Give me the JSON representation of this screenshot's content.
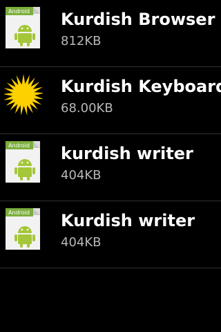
{
  "apps": [
    {
      "name": "Kurdish Browser",
      "size": "812KB",
      "icon": "android-apk-icon",
      "icon_badge": "Android"
    },
    {
      "name": "Kurdish Keyboard",
      "size": "68.00KB",
      "icon": "kurdish-sun-icon"
    },
    {
      "name": "kurdish writer",
      "size": "404KB",
      "icon": "android-apk-icon",
      "icon_badge": "Android"
    },
    {
      "name": "Kurdish writer",
      "size": "404KB",
      "icon": "android-apk-icon",
      "icon_badge": "Android"
    }
  ],
  "colors": {
    "background": "#000000",
    "divider": "#333333",
    "title": "#ffffff",
    "subtitle": "#b8b8b8",
    "android_green": "#a4c639",
    "sun_yellow": "#fdd000"
  }
}
